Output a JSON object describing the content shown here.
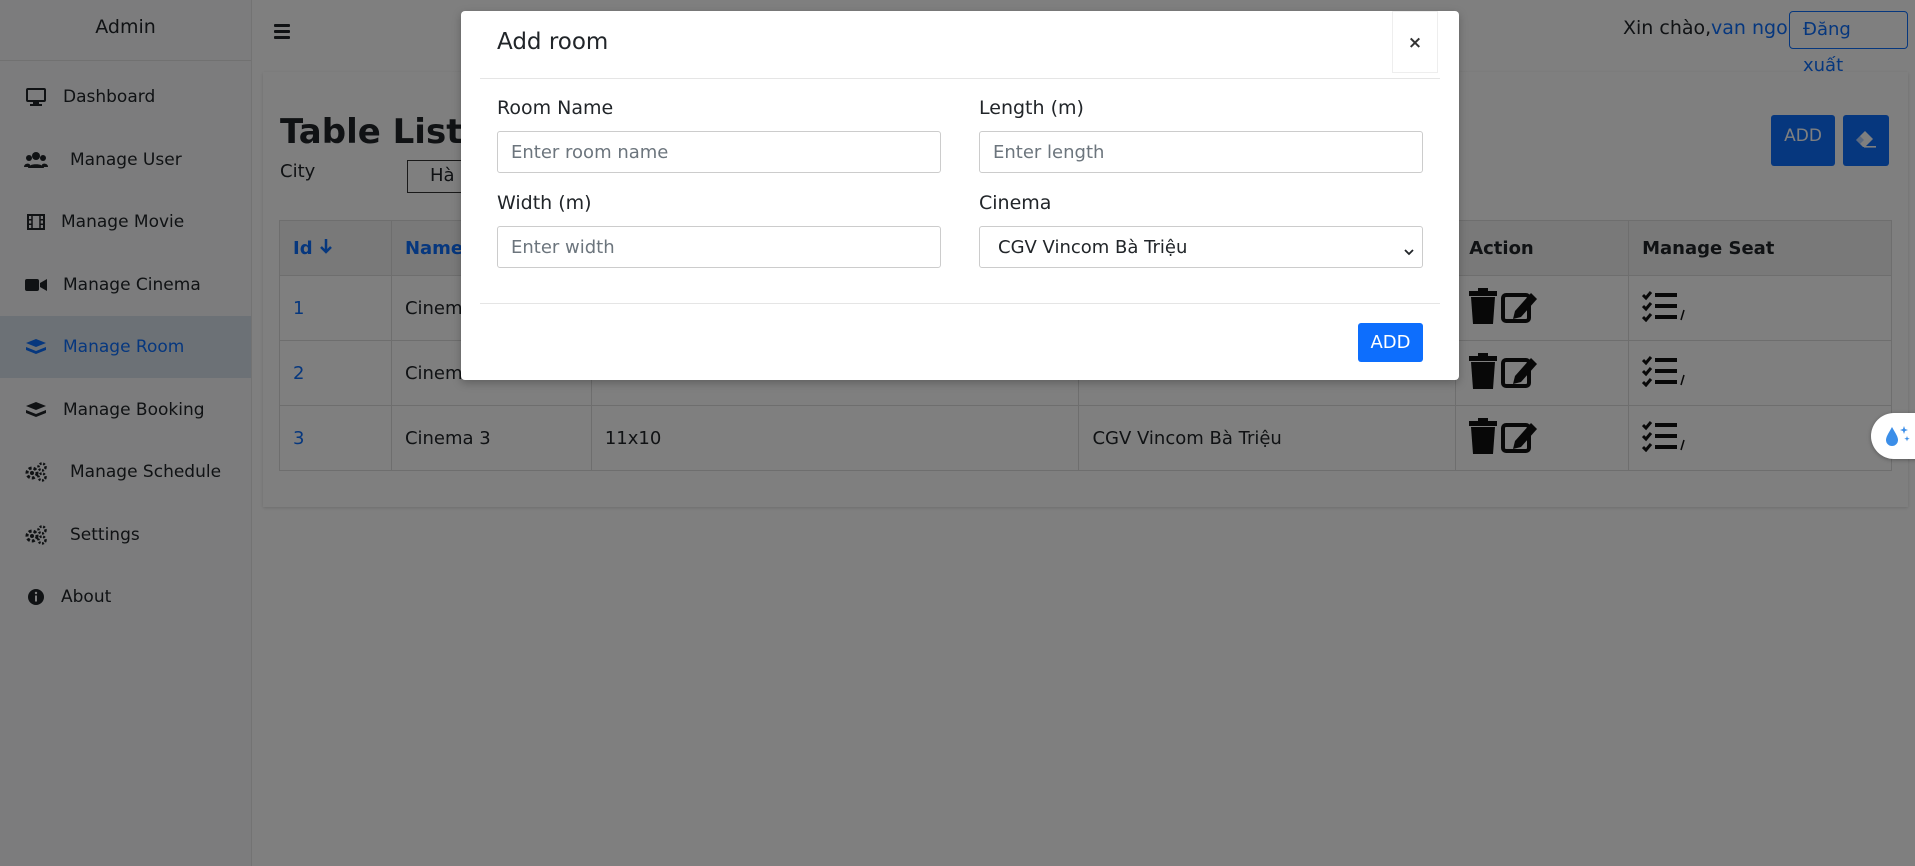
{
  "sidebar": {
    "brand": "Admin",
    "items": [
      {
        "label": "Dashboard",
        "icon": "monitor-icon"
      },
      {
        "label": "Manage User",
        "icon": "users-icon"
      },
      {
        "label": "Manage Movie",
        "icon": "film-icon"
      },
      {
        "label": "Manage Cinema",
        "icon": "video-camera-icon"
      },
      {
        "label": "Manage Room",
        "icon": "layers-icon",
        "active": true
      },
      {
        "label": "Manage Booking",
        "icon": "layers-icon"
      },
      {
        "label": "Manage Schedule",
        "icon": "gears-icon"
      },
      {
        "label": "Settings",
        "icon": "gears-icon"
      },
      {
        "label": "About",
        "icon": "info-circle-icon"
      }
    ]
  },
  "header": {
    "greeting": "Xin chào,",
    "username": "van ngo",
    "logout_label": "Đăng xuất"
  },
  "main": {
    "title": "Table List Ro",
    "city_label": "City",
    "city_value": "Hà",
    "add_label": "ADD",
    "table": {
      "headers": [
        "Id",
        "Name",
        "",
        "",
        "Action",
        "Manage Seat"
      ],
      "rows": [
        {
          "id": "1",
          "name": "Cinem",
          "size": "",
          "cinema": ""
        },
        {
          "id": "2",
          "name": "Cinem",
          "size": "",
          "cinema": ""
        },
        {
          "id": "3",
          "name": "Cinema 3",
          "size": "11x10",
          "cinema": "CGV Vincom Bà Triệu"
        }
      ]
    }
  },
  "modal": {
    "title": "Add room",
    "close_label": "×",
    "room_name_label": "Room Name",
    "room_name_placeholder": "Enter room name",
    "length_label": "Length (m)",
    "length_placeholder": "Enter length",
    "width_label": "Width (m)",
    "width_placeholder": "Enter width",
    "cinema_label": "Cinema",
    "cinema_value": "CGV Vincom Bà Triệu",
    "add_label": "ADD"
  },
  "colors": {
    "accent": "#0d6efd",
    "overlay": "rgba(0,0,0,0.5)",
    "sidebar_bg": "#f8f9fa",
    "sidebar_active_bg": "#d9e2ec"
  }
}
